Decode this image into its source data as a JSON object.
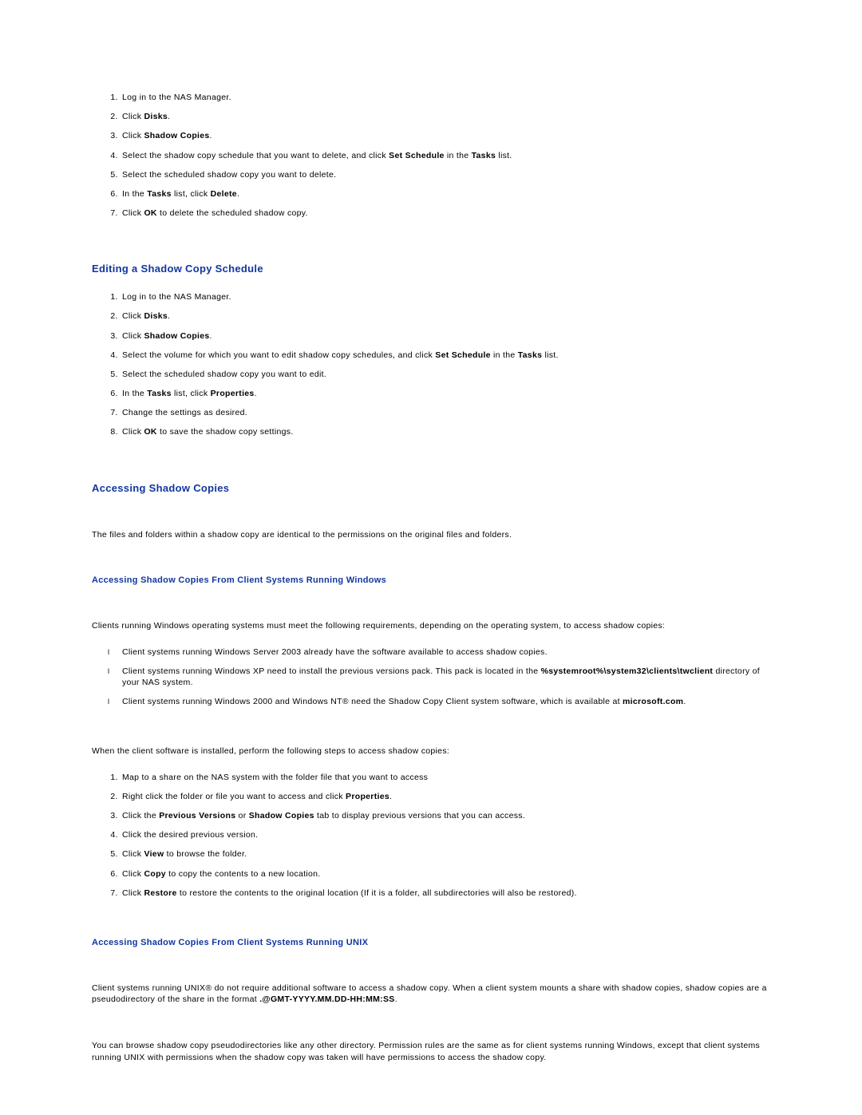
{
  "sec1": {
    "steps": [
      "Log in to the NAS Manager.",
      "Click <span class=\"b\">Disks</span>.",
      "Click <span class=\"b\">Shadow Copies</span>.",
      "Select the shadow copy schedule that you want to delete, and click <span class=\"b\">Set Schedule</span> in the <span class=\"b\">Tasks</span> list.",
      "Select the scheduled shadow copy you want to delete.",
      "In the <span class=\"b\">Tasks</span> list, click <span class=\"b\">Delete</span>.",
      "Click <span class=\"b\">OK</span> to delete the scheduled shadow copy."
    ]
  },
  "sec2": {
    "heading": "Editing a Shadow Copy Schedule",
    "steps": [
      "Log in to the NAS Manager.",
      "Click <span class=\"b\">Disks</span>.",
      "Click <span class=\"b\">Shadow Copies</span>.",
      "Select the volume for which you want to edit shadow copy schedules, and click <span class=\"b\">Set Schedule</span> in the <span class=\"b\">Tasks</span> list.",
      "Select the scheduled shadow copy you want to edit.",
      "In the <span class=\"b\">Tasks</span> list, click <span class=\"b\">Properties</span>.",
      "Change the settings as desired.",
      "Click <span class=\"b\">OK</span> to save the shadow copy settings."
    ]
  },
  "sec3": {
    "heading": "Accessing Shadow Copies",
    "intro": "The files and folders within a shadow copy are identical to the permissions on the original files and folders.",
    "sub1": {
      "heading": "Accessing Shadow Copies From Client Systems Running Windows",
      "intro": "Clients running Windows operating systems must meet the following requirements, depending on the operating system, to access shadow copies:",
      "bullets": [
        "Client systems running Windows Server 2003 already have the software available to access shadow copies.",
        "Client systems running Windows XP need to install the previous versions pack. This pack is located in the <span class=\"b\">%systemroot%\\system32\\clients\\twclient</span> directory of your NAS system.",
        "Client systems running Windows 2000 and Windows NT® need the Shadow Copy Client system software, which is available at <span class=\"b\">microsoft.com</span>."
      ],
      "lead": "When the client software is installed, perform the following steps to access shadow copies:",
      "steps": [
        "Map to a share on the NAS system with the folder file that you want to access",
        "Right click the folder or file you want to access and click <span class=\"b\">Properties</span>.",
        "Click the <span class=\"b\">Previous Versions</span> or <span class=\"b\">Shadow Copies</span> tab to display previous versions that you can access.",
        "Click the desired previous version.",
        "Click <span class=\"b\">View</span> to browse the folder.",
        "Click <span class=\"b\">Copy</span> to copy the contents to a new location.",
        "Click <span class=\"b\">Restore</span> to restore the contents to the original location (If it is a folder, all subdirectories will also be restored)."
      ]
    },
    "sub2": {
      "heading": "Accessing Shadow Copies From Client Systems Running UNIX",
      "p1": "Client systems running UNIX® do not require additional software to access a shadow copy. When a client system mounts a share with shadow copies, shadow copies are a pseudodirectory of the share in the format <span class=\"b\">.@GMT-YYYY.MM.DD-HH:MM:SS</span>.",
      "p2": "You can browse shadow copy pseudodirectories like any other directory. Permission rules are the same as for client systems running Windows, except that client systems running UNIX with permissions when the shadow copy was taken will have permissions to access the shadow copy."
    }
  }
}
